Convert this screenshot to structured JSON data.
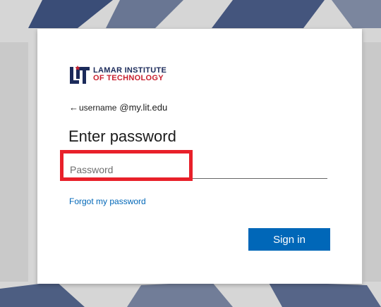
{
  "brand": {
    "logo_mark": "LIT",
    "name_line1": "LAMAR INSTITUTE",
    "name_line2": "OF TECHNOLOGY",
    "colors": {
      "navy": "#1b2a5a",
      "red": "#c8202f"
    }
  },
  "identity": {
    "back_icon": "back-arrow-icon",
    "username": "username",
    "domain": "@my.lit.edu"
  },
  "page_title": "Enter password",
  "password_field": {
    "placeholder": "Password",
    "value": ""
  },
  "forgot_link": "Forgot my password",
  "signin_button": "Sign in",
  "colors": {
    "accent": "#0067b8",
    "highlight": "#e8202a"
  }
}
